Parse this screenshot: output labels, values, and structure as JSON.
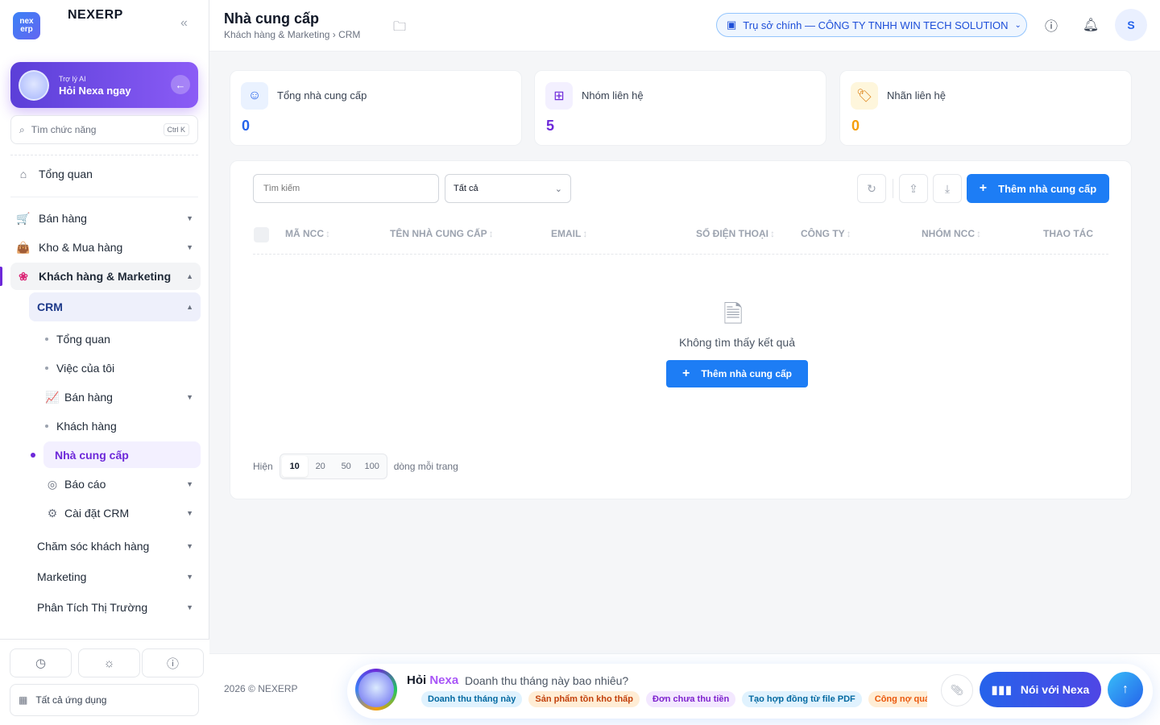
{
  "app": {
    "name": "NEXERP",
    "logo_top": "nex",
    "logo_bottom": "erp"
  },
  "ai_card": {
    "subtitle": "Trợ lý AI",
    "title": "Hỏi Nexa ngay"
  },
  "search": {
    "placeholder": "Tìm chức năng",
    "shortcut": "Ctrl K"
  },
  "sidebar": {
    "overview": "Tổng quan",
    "groups": [
      {
        "label": "Bán hàng"
      },
      {
        "label": "Kho & Mua hàng"
      },
      {
        "label": "Khách hàng & Marketing"
      }
    ],
    "crm": "CRM",
    "crm_items": [
      "Tổng quan",
      "Việc của tôi",
      "Bán hàng",
      "Khách hàng",
      "Nhà cung cấp",
      "Báo cáo",
      "Cài đặt CRM"
    ],
    "more": [
      "Chăm sóc khách hàng",
      "Marketing",
      "Phân Tích Thị Trường"
    ],
    "all_apps": "Tất cả ứng dụng"
  },
  "header": {
    "title": "Nhà cung cấp",
    "breadcrumb": "Khách hàng & Marketing › CRM",
    "branch": "Trụ sở chính — CÔNG TY TNHH WIN TECH SOLUTION",
    "avatar": "S"
  },
  "stats": [
    {
      "label": "Tổng nhà cung cấp",
      "value": "0",
      "color": "#2563eb"
    },
    {
      "label": "Nhóm liên hệ",
      "value": "5",
      "color": "#6d28d9"
    },
    {
      "label": "Nhãn liên hệ",
      "value": "0",
      "color": "#f59e0b"
    }
  ],
  "filters": {
    "search_placeholder": "Tìm kiếm",
    "select_value": "Tất cả",
    "add_label": "Thêm nhà cung cấp"
  },
  "table": {
    "columns": [
      "MÃ NCC",
      "TÊN NHÀ CUNG CẤP",
      "EMAIL",
      "SỐ ĐIỆN THOẠI",
      "CÔNG TY",
      "NHÓM NCC",
      "THAO TÁC"
    ],
    "empty_text": "Không tìm thấy kết quả",
    "empty_button": "Thêm nhà cung cấp"
  },
  "pager": {
    "prefix": "Hiện",
    "sizes": [
      "10",
      "20",
      "50",
      "100"
    ],
    "selected": "10",
    "suffix": "dòng mỗi trang"
  },
  "footer": {
    "copyright": "2026 © NEXERP"
  },
  "nexa": {
    "ask": "Hỏi",
    "name": "Nexa",
    "question": "Doanh thu tháng này bao nhiêu?",
    "chips": [
      "Doanh thu tháng này",
      "Sản phẩm tồn kho thấp",
      "Đơn chưa thu tiền",
      "Tạo hợp đồng từ file PDF",
      "Công nợ quá hạn"
    ],
    "talk_label": "Nói với Nexa"
  }
}
